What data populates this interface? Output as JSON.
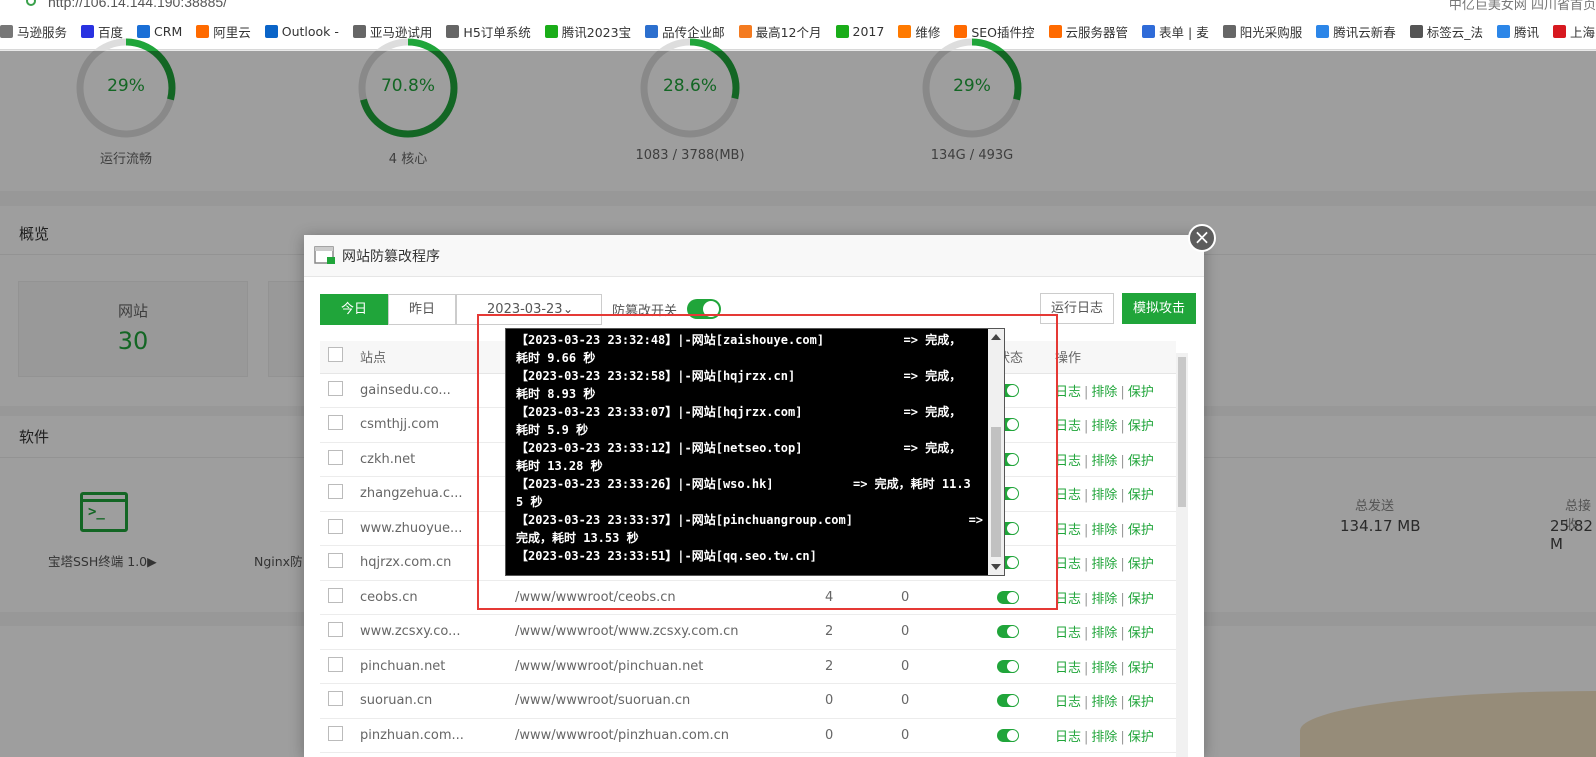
{
  "browser": {
    "url": "http://106.14.144.190:38885/",
    "right_text": "中亿巨美女网 四川省首页"
  },
  "bookmarks": [
    {
      "label": "马逊服务",
      "icon": "bookmark-icon",
      "color": "#777"
    },
    {
      "label": "百度",
      "icon": "baidu-paw-icon",
      "color": "#2932e1"
    },
    {
      "label": "CRM",
      "icon": "x-logo-icon",
      "color": "#1a6fd6"
    },
    {
      "label": "阿里云",
      "icon": "aliyun-icon",
      "color": "#ff6a00"
    },
    {
      "label": "Outlook -",
      "icon": "outlook-icon",
      "color": "#0a64c8"
    },
    {
      "label": "亚马逊试用",
      "icon": "doc-icon",
      "color": "#666"
    },
    {
      "label": "H5订单系统",
      "icon": "doc-icon",
      "color": "#666"
    },
    {
      "label": "腾讯2023宝",
      "icon": "shield-icon",
      "color": "#1aad19"
    },
    {
      "label": "品传企业邮",
      "icon": "mail-icon",
      "color": "#2c6fce"
    },
    {
      "label": "最高12个月",
      "icon": "cube-icon",
      "color": "#f47b20"
    },
    {
      "label": "2017",
      "icon": "shield-icon",
      "color": "#1aad19"
    },
    {
      "label": "维修",
      "icon": "e-circle-icon",
      "color": "#ff7a00"
    },
    {
      "label": "SEO插件控",
      "icon": "aliyun-icon",
      "color": "#ff6a00"
    },
    {
      "label": "云服务器管",
      "icon": "aliyun-icon",
      "color": "#ff6a00"
    },
    {
      "label": "表单 | 麦",
      "icon": "m-logo-icon",
      "color": "#2f6bd8"
    },
    {
      "label": "阳光采购服",
      "icon": "doc-icon",
      "color": "#666"
    },
    {
      "label": "腾讯云新春",
      "icon": "cloud-icon",
      "color": "#2c86e8"
    },
    {
      "label": "标签云_法",
      "icon": "cloud-small-icon",
      "color": "#555"
    },
    {
      "label": "腾讯",
      "icon": "cloud-icon",
      "color": "#2c86e8"
    },
    {
      "label": "上海品",
      "icon": "h-logo-icon",
      "color": "#d71920"
    }
  ],
  "gauges": [
    {
      "value": "29%",
      "label": "运行流畅",
      "percent": 29
    },
    {
      "value": "70.8%",
      "label": "4 核心",
      "percent": 70.8
    },
    {
      "value": "28.6%",
      "label": "1083 / 3788(MB)",
      "percent": 28.6
    },
    {
      "value": "29%",
      "label": "134G / 493G",
      "percent": 29
    }
  ],
  "overview": {
    "title": "概览",
    "site_label": "网站",
    "site_count": "30"
  },
  "software": {
    "title": "软件",
    "items": [
      "宝塔SSH终端 1.0▶",
      "Nginx防"
    ]
  },
  "traffic": {
    "sent_label": "总发送",
    "sent_value": "134.17 MB",
    "recv_label": "总接收",
    "recv_value": "25.82 M"
  },
  "dialog": {
    "title": "网站防篡改程序",
    "tabs": [
      "今日",
      "昨日"
    ],
    "date": "2023-03-23",
    "switch_label": "防篡改开关",
    "log_button": "运行日志",
    "attack_button": "模拟攻击",
    "columns": [
      "站点",
      "状态",
      "操作"
    ],
    "op_log": "日志",
    "op_exclude": "排除",
    "op_protect": "保护",
    "rows": [
      {
        "site": "gainsedu.co...",
        "path": "",
        "n1": "",
        "n2": ""
      },
      {
        "site": "csmthjj.com",
        "path": "",
        "n1": "",
        "n2": ""
      },
      {
        "site": "czkh.net",
        "path": "",
        "n1": "",
        "n2": ""
      },
      {
        "site": "zhangzehua.c...",
        "path": "",
        "n1": "",
        "n2": ""
      },
      {
        "site": "www.zhuoyue...",
        "path": "",
        "n1": "",
        "n2": ""
      },
      {
        "site": "hqjrzx.com.cn",
        "path": "",
        "n1": "",
        "n2": ""
      },
      {
        "site": "ceobs.cn",
        "path": "/www/wwwroot/ceobs.cn",
        "n1": "4",
        "n2": "0"
      },
      {
        "site": "www.zcsxy.co...",
        "path": "/www/wwwroot/www.zcsxy.com.cn",
        "n1": "2",
        "n2": "0"
      },
      {
        "site": "pinchuan.net",
        "path": "/www/wwwroot/pinchuan.net",
        "n1": "2",
        "n2": "0"
      },
      {
        "site": "suoruan.cn",
        "path": "/www/wwwroot/suoruan.cn",
        "n1": "0",
        "n2": "0"
      },
      {
        "site": "pinzhuan.com...",
        "path": "/www/wwwroot/pinzhuan.com.cn",
        "n1": "0",
        "n2": "0"
      }
    ]
  },
  "console": {
    "lines": [
      "【2023-03-23 23:32:48】|-网站[zaishouye.com]           => 完成，",
      "耗时 9.66 秒",
      "【2023-03-23 23:32:58】|-网站[hqjrzx.cn]               => 完成，",
      "耗时 8.93 秒",
      "【2023-03-23 23:33:07】|-网站[hqjrzx.com]              => 完成，",
      "耗时 5.9 秒",
      "【2023-03-23 23:33:12】|-网站[netseo.top]              => 完成，",
      "耗时 13.28 秒",
      "【2023-03-23 23:33:26】|-网站[wso.hk]           => 完成，耗时 11.3",
      "5 秒",
      "【2023-03-23 23:33:37】|-网站[pinchuangroup.com]                =>",
      "完成，耗时 13.53 秒",
      "【2023-03-23 23:33:51】|-网站[qq.seo.tw.cn]"
    ]
  }
}
